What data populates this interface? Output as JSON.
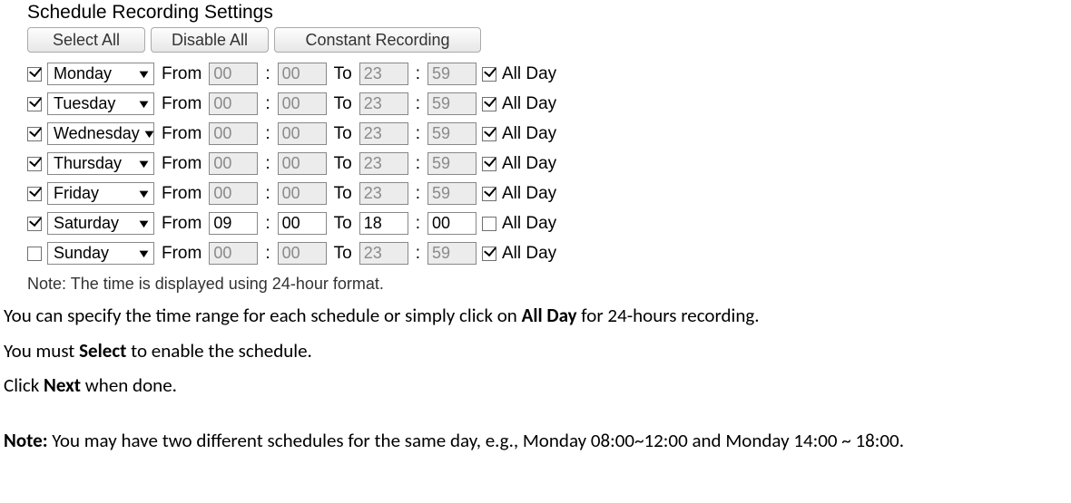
{
  "settings": {
    "title": "Schedule Recording Settings",
    "buttons": {
      "select_all": "Select All",
      "disable_all": "Disable All",
      "constant_recording": "Constant Recording"
    },
    "labels": {
      "from": "From",
      "to": "To",
      "colon": ":",
      "all_day": "All Day"
    },
    "rows": [
      {
        "enabled": true,
        "day": "Monday",
        "from_h": "00",
        "from_m": "00",
        "to_h": "23",
        "to_m": "59",
        "all_day": true,
        "editable": false
      },
      {
        "enabled": true,
        "day": "Tuesday",
        "from_h": "00",
        "from_m": "00",
        "to_h": "23",
        "to_m": "59",
        "all_day": true,
        "editable": false
      },
      {
        "enabled": true,
        "day": "Wednesday",
        "from_h": "00",
        "from_m": "00",
        "to_h": "23",
        "to_m": "59",
        "all_day": true,
        "editable": false
      },
      {
        "enabled": true,
        "day": "Thursday",
        "from_h": "00",
        "from_m": "00",
        "to_h": "23",
        "to_m": "59",
        "all_day": true,
        "editable": false
      },
      {
        "enabled": true,
        "day": "Friday",
        "from_h": "00",
        "from_m": "00",
        "to_h": "23",
        "to_m": "59",
        "all_day": true,
        "editable": false
      },
      {
        "enabled": true,
        "day": "Saturday",
        "from_h": "09",
        "from_m": "00",
        "to_h": "18",
        "to_m": "00",
        "all_day": false,
        "editable": true
      },
      {
        "enabled": false,
        "day": "Sunday",
        "from_h": "00",
        "from_m": "00",
        "to_h": "23",
        "to_m": "59",
        "all_day": true,
        "editable": false
      }
    ],
    "format_note": "Note: The time is displayed using 24-hour format."
  },
  "doc": {
    "p1a": "You can specify the time range for each schedule or simply click on ",
    "p1b": "All Day",
    "p1c": " for 24-hours recording.",
    "p2a": "You must ",
    "p2b": "Select",
    "p2c": " to enable the schedule.",
    "p3a": "Click ",
    "p3b": "Next",
    "p3c": " when done.",
    "p4a": "Note:",
    "p4b": " You may have two different schedules for the same day, e.g., Monday 08:00~12:00 and Monday 14:00 ~ 18:00."
  }
}
